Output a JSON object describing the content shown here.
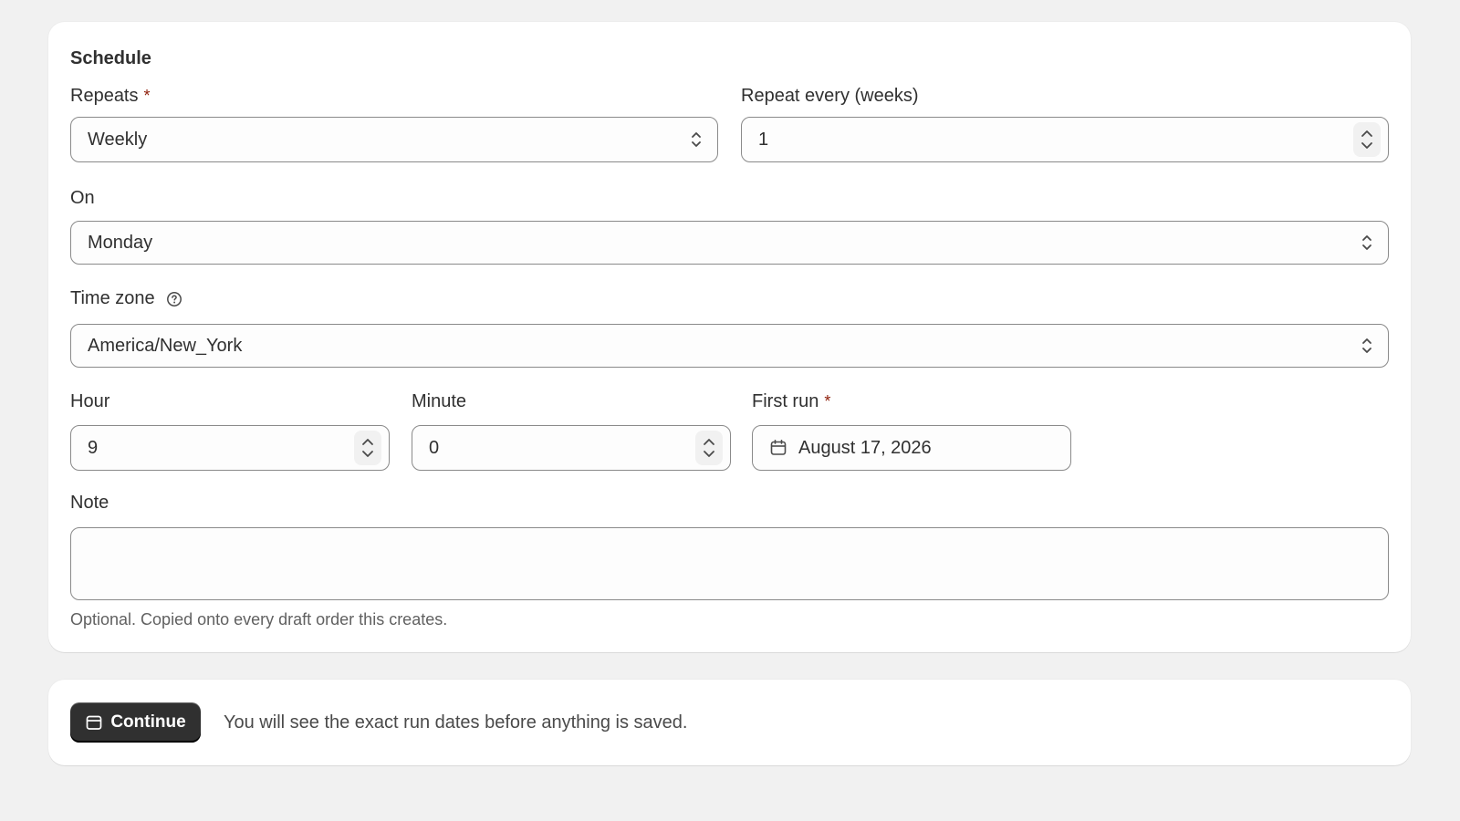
{
  "schedule": {
    "title": "Schedule",
    "repeats": {
      "label": "Repeats",
      "required_mark": "*",
      "value": "Weekly"
    },
    "repeat_every": {
      "label": "Repeat every (weeks)",
      "value": "1"
    },
    "on": {
      "label": "On",
      "value": "Monday"
    },
    "time_zone": {
      "label": "Time zone",
      "value": "America/New_York"
    },
    "hour": {
      "label": "Hour",
      "value": "9"
    },
    "minute": {
      "label": "Minute",
      "value": "0"
    },
    "first_run": {
      "label": "First run",
      "required_mark": "*",
      "value": "August 17, 2026"
    },
    "note": {
      "label": "Note",
      "value": "",
      "help": "Optional. Copied onto every draft order this creates."
    }
  },
  "actions": {
    "continue_label": "Continue",
    "info_text": "You will see the exact run dates before anything is saved."
  },
  "colors": {
    "background": "#f1f1f1",
    "card": "#ffffff",
    "required": "#8e1f0b",
    "primary_button": "#303030"
  },
  "icons": {
    "select": "chevron-up-down-icon",
    "stepper": "stepper-icon",
    "help": "question-circle-icon",
    "calendar": "calendar-icon"
  }
}
